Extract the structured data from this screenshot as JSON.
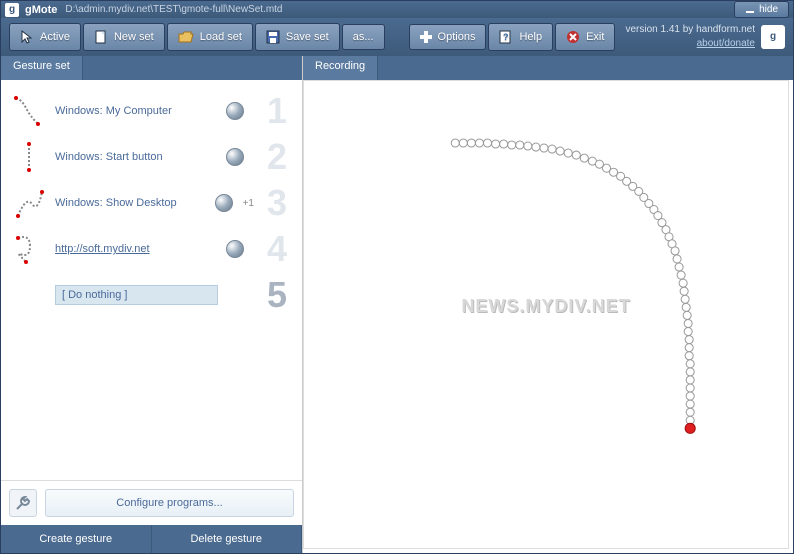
{
  "titlebar": {
    "app_name": "gMote",
    "file_path": "D:\\admin.mydiv.net\\TEST\\gmote-full\\NewSet.mtd",
    "hide_label": "hide"
  },
  "toolbar": {
    "active": "Active",
    "new_set": "New set",
    "load_set": "Load set",
    "save_set": "Save set",
    "save_as": "as...",
    "options": "Options",
    "help": "Help",
    "exit": "Exit",
    "version_line": "version 1.41 by handform.net",
    "about_link": "about/donate"
  },
  "tabs": {
    "gesture_set": "Gesture set",
    "recording": "Recording"
  },
  "gestures": [
    {
      "label": "Windows: My Computer",
      "num": "1",
      "link": false,
      "extra": ""
    },
    {
      "label": "Windows: Start button",
      "num": "2",
      "link": false,
      "extra": ""
    },
    {
      "label": "Windows: Show Desktop",
      "num": "3",
      "link": false,
      "extra": "+1"
    },
    {
      "label": "http://soft.mydiv.net",
      "num": "4",
      "link": true,
      "extra": ""
    },
    {
      "label": "[ Do nothing ]",
      "num": "5",
      "link": false,
      "extra": "",
      "selected": true
    }
  ],
  "buttons": {
    "configure": "Configure programs...",
    "create": "Create gesture",
    "delete": "Delete gesture"
  },
  "watermark": "NEWS.MYDIV.NET",
  "icons": {
    "logo_glyph": "g"
  }
}
